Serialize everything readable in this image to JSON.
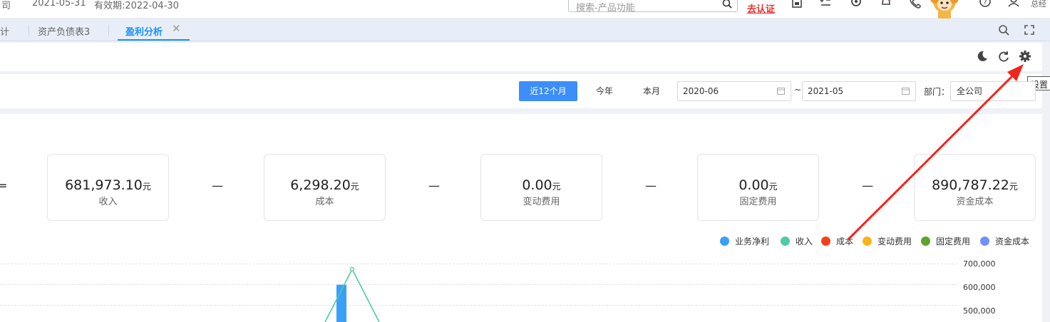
{
  "topbar": {
    "company_fragment": "司",
    "date": "2021-05-31",
    "validity": "有效期:2022-04-30",
    "search_placeholder": "搜索-产品功能",
    "verify_label": "去认证",
    "user_fragment": "总经"
  },
  "tabs": [
    {
      "label": "计"
    },
    {
      "label": "资产负债表3"
    },
    {
      "label": "盈利分析",
      "active": true
    }
  ],
  "tooltip": "设置",
  "filters": {
    "buttons": [
      "近12个月",
      "今年",
      "本月"
    ],
    "date_from": "2020-06",
    "date_to": "2021-05",
    "tilde": "~",
    "dept_label": "部门：",
    "dept_value": "全公司"
  },
  "summary": {
    "equals": "=",
    "minus": "—",
    "unit": "元",
    "cards": [
      {
        "value": "681,973.10",
        "label": "收入"
      },
      {
        "value": "6,298.20",
        "label": "成本"
      },
      {
        "value": "0.00",
        "label": "变动费用"
      },
      {
        "value": "0.00",
        "label": "固定费用"
      },
      {
        "value": "890,787.22",
        "label": "资金成本"
      }
    ]
  },
  "legend": [
    {
      "name": "业务净利",
      "color": "#3aa0f7"
    },
    {
      "name": "收入",
      "color": "#4ecba6"
    },
    {
      "name": "成本",
      "color": "#f0411c"
    },
    {
      "name": "变动费用",
      "color": "#f8b418"
    },
    {
      "name": "固定费用",
      "color": "#5fa22d"
    },
    {
      "name": "资金成本",
      "color": "#7291f7"
    }
  ],
  "chart_data": {
    "type": "bar",
    "yticks": [
      "700,000",
      "600,000",
      "500,000"
    ],
    "ylim": [
      500000,
      700000
    ],
    "series": [
      {
        "name": "业务净利",
        "type": "bar",
        "values": [
          610000
        ]
      },
      {
        "name": "收入",
        "type": "line",
        "values": [
          681973.1
        ]
      }
    ]
  },
  "colors": {
    "accent": "#1890ff",
    "primary_button": "#3d8ef8",
    "annotation_arrow": "#f0261b"
  }
}
